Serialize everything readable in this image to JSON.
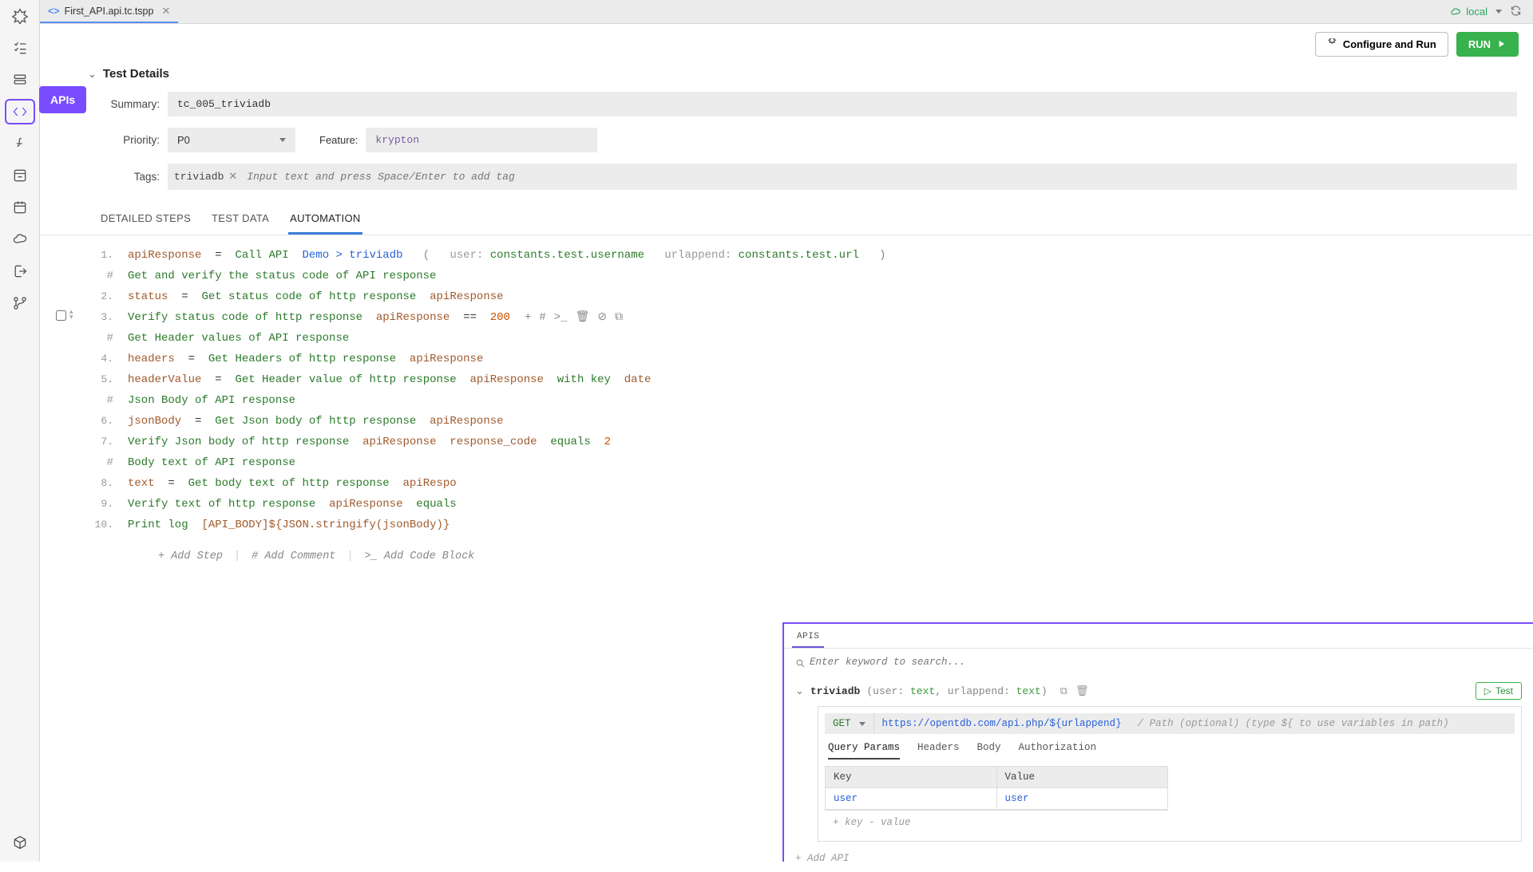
{
  "tab": {
    "filename": "First_API.api.tc.tspp"
  },
  "env": {
    "label": "local"
  },
  "actions": {
    "configure": "Configure and Run",
    "run": "RUN"
  },
  "sidebar_tooltip": "APIs",
  "details": {
    "header": "Test Details",
    "summary_label": "Summary:",
    "summary_value": "tc_005_triviadb",
    "priority_label": "Priority:",
    "priority_value": "P0",
    "feature_label": "Feature:",
    "feature_value": "krypton",
    "tags_label": "Tags:",
    "tag1": "triviadb",
    "tags_placeholder": "Input text and press Space/Enter to add tag"
  },
  "content_tabs": {
    "t1": "DETAILED STEPS",
    "t2": "TEST DATA",
    "t3": "AUTOMATION"
  },
  "steps": {
    "l1": {
      "n": "1.",
      "v": "apiResponse",
      "eq": "=",
      "fn": "Call API",
      "api": "Demo > triviadb",
      "p1l": "user:",
      "p1v": "constants.test.username",
      "p2l": "urlappend:",
      "p2v": "constants.test.url"
    },
    "c1": "Get and verify the status code of API response",
    "l2": {
      "n": "2.",
      "v": "status",
      "eq": "=",
      "fn": "Get status code of http response",
      "a1": "apiResponse"
    },
    "l3": {
      "n": "3.",
      "fn": "Verify status code of http response",
      "a1": "apiResponse",
      "op": "==",
      "num": "200"
    },
    "c2": "Get Header values of API response",
    "l4": {
      "n": "4.",
      "v": "headers",
      "eq": "=",
      "fn": "Get Headers of http response",
      "a1": "apiResponse"
    },
    "l5": {
      "n": "5.",
      "v": "headerValue",
      "eq": "=",
      "fn": "Get Header value of http response",
      "a1": "apiResponse",
      "wk": "with key",
      "k": "date"
    },
    "c3": "Json Body of API response",
    "l6": {
      "n": "6.",
      "v": "jsonBody",
      "eq": "=",
      "fn": "Get Json body of http response",
      "a1": "apiResponse"
    },
    "l7": {
      "n": "7.",
      "fn": "Verify Json body of http response",
      "a1": "apiResponse",
      "a2": "response_code",
      "op": "equals",
      "num": "2"
    },
    "c4": "Body text of API response",
    "l8": {
      "n": "8.",
      "v": "text",
      "eq": "=",
      "fn": "Get body text of http response",
      "a1": "apiRespo"
    },
    "l9": {
      "n": "9.",
      "fn": "Verify text of http response",
      "a1": "apiResponse",
      "op": "equals"
    },
    "l10": {
      "n": "10.",
      "fn": "Print log",
      "a1": "[API_BODY]${JSON.stringify(jsonBody)}"
    }
  },
  "add": {
    "step": "+ Add Step",
    "comment": "# Add Comment",
    "block": ">_ Add Code Block"
  },
  "api_panel": {
    "tab": "APIS",
    "search_ph": "Enter keyword to search...",
    "entry_name": "triviadb",
    "entry_sig_open": "(",
    "entry_p1": "user:",
    "entry_p1t": "text",
    "entry_comma": ", ",
    "entry_p2": "urlappend:",
    "entry_p2t": "text",
    "entry_sig_close": ")",
    "test_btn": "Test",
    "method": "GET",
    "url": "https://opentdb.com/api.php/${urlappend}",
    "url_ph": "/ Path (optional) (type ${ to use variables in path)",
    "subtabs": {
      "t1": "Query Params",
      "t2": "Headers",
      "t3": "Body",
      "t4": "Authorization"
    },
    "kv": {
      "kh": "Key",
      "vh": "Value",
      "k1": "user",
      "v1": "user",
      "add": "+ key - value"
    },
    "add_api": "+ Add API"
  }
}
